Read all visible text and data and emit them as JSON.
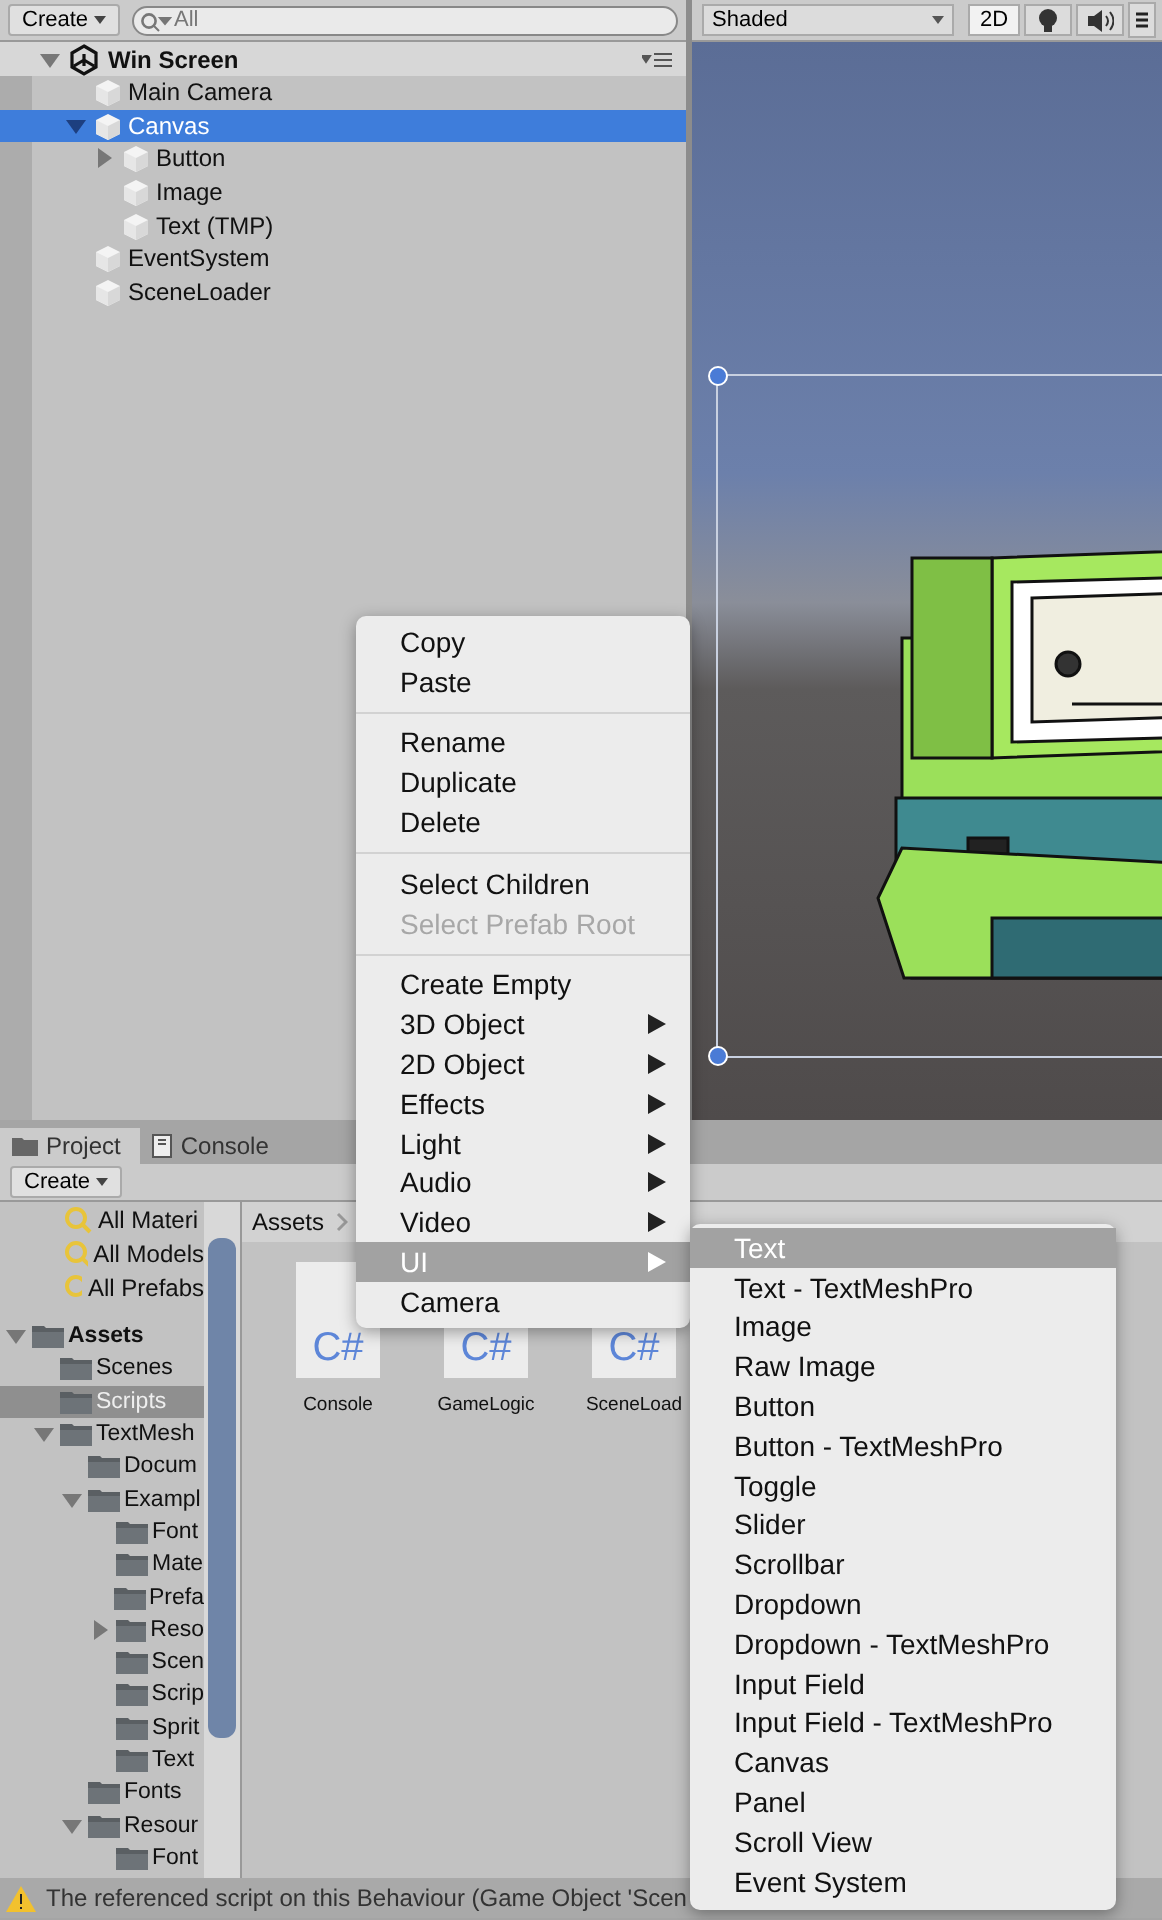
{
  "hierarchy": {
    "create_button": "Create",
    "search": {
      "placeholder": "All"
    },
    "scene": {
      "name": "Win Screen",
      "expanded": true
    },
    "items": [
      {
        "label": "Main Camera",
        "selected": false
      },
      {
        "label": "Canvas",
        "selected": true,
        "expanded": true,
        "children": [
          {
            "label": "Button",
            "selected": false,
            "expanded": false
          },
          {
            "label": "Image",
            "selected": false
          },
          {
            "label": "Text (TMP)",
            "selected": false
          }
        ]
      },
      {
        "label": "EventSystem",
        "selected": false
      },
      {
        "label": "SceneLoader",
        "selected": false
      }
    ]
  },
  "scene_view": {
    "shading_mode": "Shaded",
    "mode_button": "2D"
  },
  "project": {
    "tabs": [
      {
        "label": "Project",
        "selected": true
      },
      {
        "label": "Console",
        "selected": false
      }
    ],
    "create_button": "Create",
    "favorites": [
      "All Materi",
      "All Models",
      "All Prefabs"
    ],
    "tree": [
      {
        "label": "Assets",
        "selected": false,
        "expanded": true,
        "children": [
          {
            "label": "Scenes",
            "selected": false
          },
          {
            "label": "Scripts",
            "selected": true
          },
          {
            "label": "TextMesh",
            "selected": false,
            "expanded": true,
            "children": [
              {
                "label": "Docum",
                "selected": false
              },
              {
                "label": "Exampl",
                "selected": false,
                "expanded": true,
                "children": [
                  {
                    "label": "Font",
                    "selected": false
                  },
                  {
                    "label": "Mate",
                    "selected": false
                  },
                  {
                    "label": "Prefa",
                    "selected": false
                  },
                  {
                    "label": "Reso",
                    "selected": false,
                    "expanded": false
                  },
                  {
                    "label": "Scen",
                    "selected": false
                  },
                  {
                    "label": "Scrip",
                    "selected": false
                  },
                  {
                    "label": "Sprit",
                    "selected": false
                  },
                  {
                    "label": "Text",
                    "selected": false
                  }
                ]
              },
              {
                "label": "Fonts",
                "selected": false
              },
              {
                "label": "Resour",
                "selected": false,
                "expanded": true,
                "children": [
                  {
                    "label": "Font",
                    "selected": false
                  }
                ]
              }
            ]
          }
        ]
      }
    ],
    "breadcrumb": "Assets",
    "assets": [
      {
        "icon_text": "C#",
        "name": "Console"
      },
      {
        "icon_text": "C#",
        "name": "GameLogic"
      },
      {
        "icon_text": "C#",
        "name": "SceneLoad"
      }
    ]
  },
  "context_menu": {
    "groups": [
      [
        {
          "label": "Copy",
          "disabled": false,
          "selected": false,
          "submenu": false
        },
        {
          "label": "Paste",
          "disabled": false,
          "selected": false,
          "submenu": false
        }
      ],
      [
        {
          "label": "Rename",
          "disabled": false,
          "selected": false,
          "submenu": false
        },
        {
          "label": "Duplicate",
          "disabled": false,
          "selected": false,
          "submenu": false
        },
        {
          "label": "Delete",
          "disabled": false,
          "selected": false,
          "submenu": false
        }
      ],
      [
        {
          "label": "Select Children",
          "disabled": false,
          "selected": false,
          "submenu": false
        },
        {
          "label": "Select Prefab Root",
          "disabled": true,
          "selected": false,
          "submenu": false
        }
      ],
      [
        {
          "label": "Create Empty",
          "disabled": false,
          "selected": false,
          "submenu": false
        },
        {
          "label": "3D Object",
          "disabled": false,
          "selected": false,
          "submenu": true
        },
        {
          "label": "2D Object",
          "disabled": false,
          "selected": false,
          "submenu": true
        },
        {
          "label": "Effects",
          "disabled": false,
          "selected": false,
          "submenu": true
        },
        {
          "label": "Light",
          "disabled": false,
          "selected": false,
          "submenu": true
        },
        {
          "label": "Audio",
          "disabled": false,
          "selected": false,
          "submenu": true
        },
        {
          "label": "Video",
          "disabled": false,
          "selected": false,
          "submenu": true
        },
        {
          "label": "UI",
          "disabled": false,
          "selected": true,
          "submenu": true
        },
        {
          "label": "Camera",
          "disabled": false,
          "selected": false,
          "submenu": false
        }
      ]
    ]
  },
  "submenu": {
    "items": [
      {
        "label": "Text",
        "selected": true
      },
      {
        "label": "Text - TextMeshPro",
        "selected": false
      },
      {
        "label": "Image",
        "selected": false
      },
      {
        "label": "Raw Image",
        "selected": false
      },
      {
        "label": "Button",
        "selected": false
      },
      {
        "label": "Button - TextMeshPro",
        "selected": false
      },
      {
        "label": "Toggle",
        "selected": false
      },
      {
        "label": "Slider",
        "selected": false
      },
      {
        "label": "Scrollbar",
        "selected": false
      },
      {
        "label": "Dropdown",
        "selected": false
      },
      {
        "label": "Dropdown - TextMeshPro",
        "selected": false
      },
      {
        "label": "Input Field",
        "selected": false
      },
      {
        "label": "Input Field - TextMeshPro",
        "selected": false
      },
      {
        "label": "Canvas",
        "selected": false
      },
      {
        "label": "Panel",
        "selected": false
      },
      {
        "label": "Scroll View",
        "selected": false
      },
      {
        "label": "Event System",
        "selected": false
      }
    ]
  },
  "status_bar": {
    "message": "The referenced script on this Behaviour (Game Object 'Scen"
  }
}
